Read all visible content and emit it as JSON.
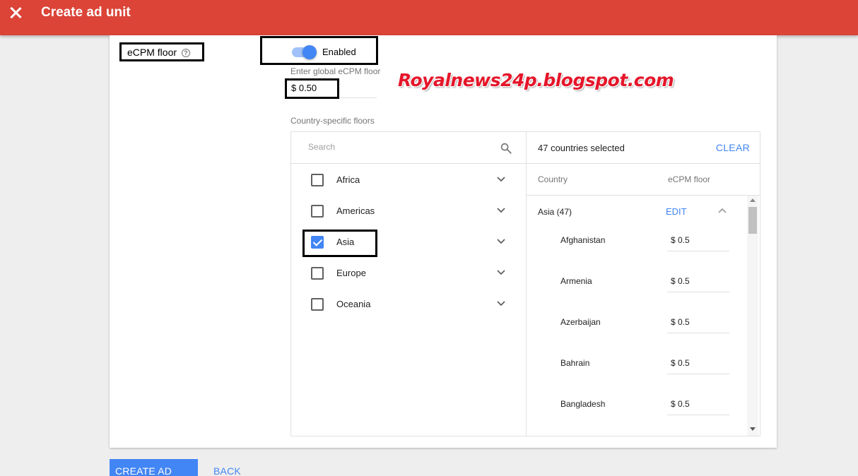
{
  "header": {
    "title": "Create ad unit"
  },
  "ecpm": {
    "label": "eCPM floor",
    "help": "?",
    "toggle_label": "Enabled",
    "global_floor_caption": "Enter global eCPM floor",
    "global_floor_value": "$ 0.50",
    "country_floors_caption": "Country-specific floors"
  },
  "picker": {
    "search_placeholder": "Search",
    "regions": [
      {
        "label": "Africa",
        "checked": false
      },
      {
        "label": "Americas",
        "checked": false
      },
      {
        "label": "Asia",
        "checked": true
      },
      {
        "label": "Europe",
        "checked": false
      },
      {
        "label": "Oceania",
        "checked": false
      }
    ],
    "selected_count": "47 countries selected",
    "clear_label": "CLEAR",
    "col_country": "Country",
    "col_floor": "eCPM floor",
    "group": {
      "name": "Asia (47)",
      "edit_label": "EDIT"
    },
    "countries": [
      {
        "name": "Afghanistan",
        "floor": "$ 0.5"
      },
      {
        "name": "Armenia",
        "floor": "$ 0.5"
      },
      {
        "name": "Azerbaijan",
        "floor": "$ 0.5"
      },
      {
        "name": "Bahrain",
        "floor": "$ 0.5"
      },
      {
        "name": "Bangladesh",
        "floor": "$ 0.5"
      }
    ]
  },
  "watermark": "Royalnews24p.blogspot.com",
  "footer": {
    "create_label": "CREATE AD UNIT",
    "back_label": "BACK"
  },
  "colors": {
    "header": "#db4437",
    "accent": "#4285f4",
    "annotation_border": "#000000",
    "watermark": "#e5162a"
  },
  "icons": {
    "close": "close-icon",
    "help": "help-circle-icon",
    "search": "search-icon",
    "expand": "chevron-down-icon",
    "collapse": "chevron-up-icon"
  }
}
